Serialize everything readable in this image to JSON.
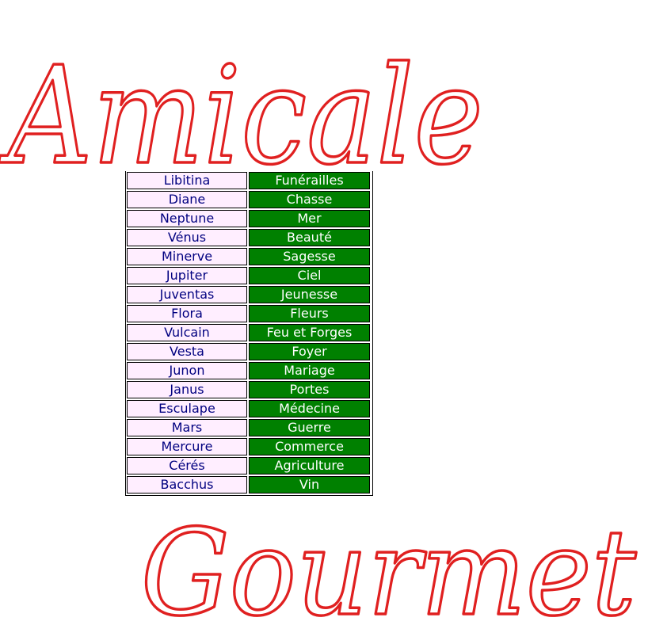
{
  "annotations": {
    "top_word": "Amicale",
    "bottom_word": "Gourmet",
    "ink_color": "#e02020"
  },
  "colors": {
    "god_bg": "#ffeeff",
    "god_text": "#000080",
    "domain_bg": "#008000",
    "domain_text": "#ffffff"
  },
  "rows": [
    {
      "god": "Libitina",
      "domain": "Funérailles"
    },
    {
      "god": "Diane",
      "domain": "Chasse"
    },
    {
      "god": "Neptune",
      "domain": "Mer"
    },
    {
      "god": "Vénus",
      "domain": "Beauté"
    },
    {
      "god": "Minerve",
      "domain": "Sagesse"
    },
    {
      "god": "Jupiter",
      "domain": "Ciel"
    },
    {
      "god": "Juventas",
      "domain": "Jeunesse"
    },
    {
      "god": "Flora",
      "domain": "Fleurs"
    },
    {
      "god": "Vulcain",
      "domain": "Feu et Forges"
    },
    {
      "god": "Vesta",
      "domain": "Foyer"
    },
    {
      "god": "Junon",
      "domain": "Mariage"
    },
    {
      "god": "Janus",
      "domain": "Portes"
    },
    {
      "god": "Esculape",
      "domain": "Médecine"
    },
    {
      "god": "Mars",
      "domain": "Guerre"
    },
    {
      "god": "Mercure",
      "domain": "Commerce"
    },
    {
      "god": "Cérés",
      "domain": "Agriculture"
    },
    {
      "god": "Bacchus",
      "domain": "Vin"
    }
  ]
}
